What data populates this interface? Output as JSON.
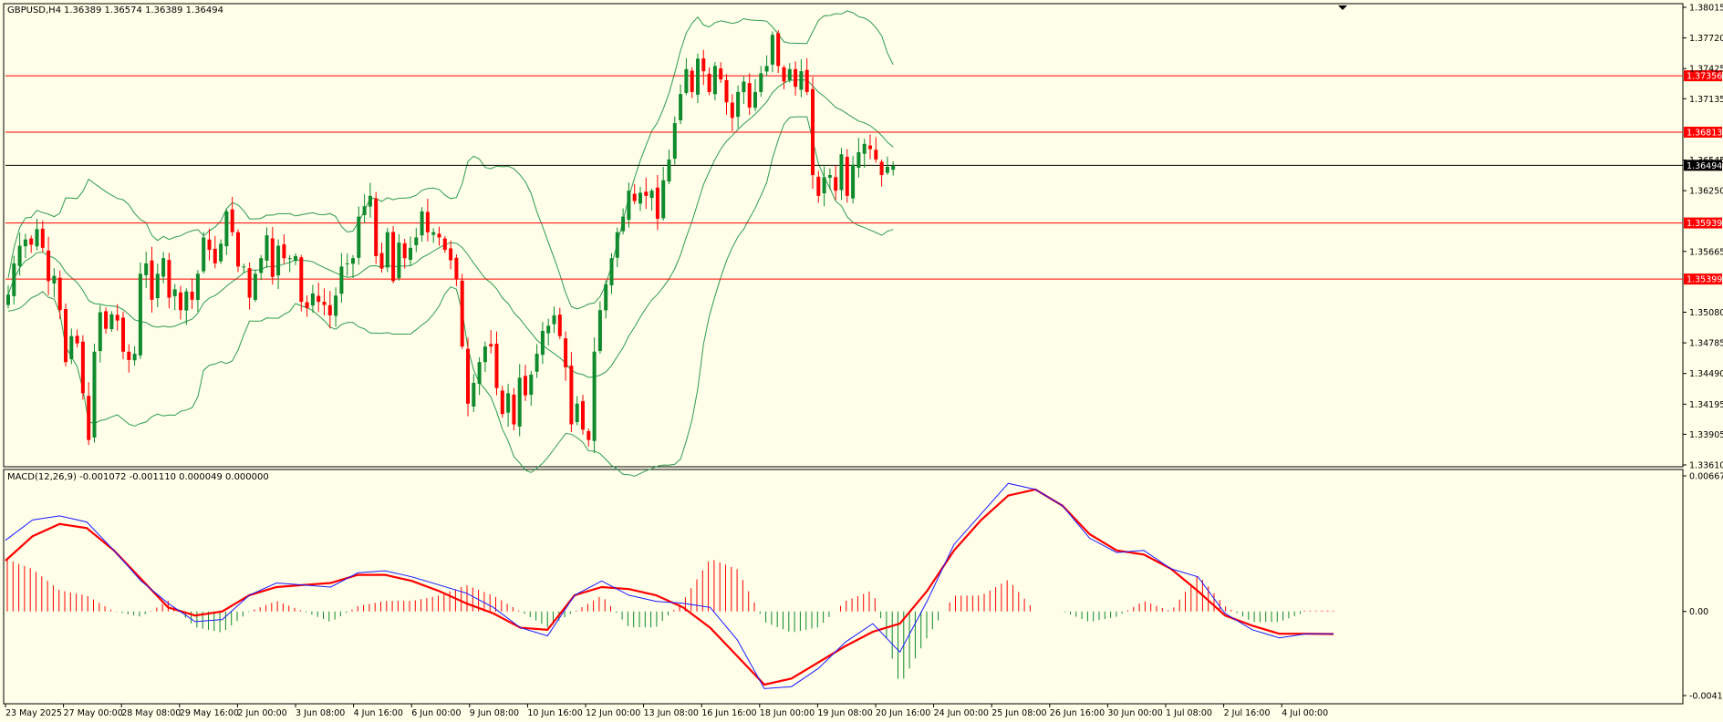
{
  "header": {
    "symbol_label": "GBPUSD,H4",
    "ohlc_label": "1.36389 1.36574 1.36389 1.36494",
    "macd_label": "MACD(12,26,9) -0.001072 -0.001110 0.000049 0.000000"
  },
  "colors": {
    "background": "#fefee9",
    "bull": "#0f8a2c",
    "bear": "#ff0000",
    "band": "#2e9c4f",
    "level_line": "#ff0000",
    "current_price_line": "#000000",
    "macd_main": "#1a1aff",
    "macd_signal": "#ff0000"
  },
  "chart_data": [
    {
      "type": "candlestick",
      "title": "GBPUSD,H4",
      "ylim": [
        1.3361,
        1.38015
      ],
      "y_ticks": [
        "1.38015",
        "1.37720",
        "1.37425",
        "1.37135",
        "1.36545",
        "1.36250",
        "1.35665",
        "1.35080",
        "1.34785",
        "1.34490",
        "1.34195",
        "1.33905",
        "1.33610"
      ],
      "x_ticks": [
        "23 May 2025",
        "27 May 00:00",
        "28 May 08:00",
        "29 May 16:00",
        "2 Jun 00:00",
        "3 Jun 08:00",
        "4 Jun 16:00",
        "6 Jun 00:00",
        "9 Jun 08:00",
        "10 Jun 16:00",
        "12 Jun 00:00",
        "13 Jun 08:00",
        "16 Jun 16:00",
        "18 Jun 00:00",
        "19 Jun 08:00",
        "20 Jun 16:00",
        "24 Jun 00:00",
        "25 Jun 08:00",
        "26 Jun 16:00",
        "30 Jun 00:00",
        "1 Jul 08:00",
        "2 Jul 16:00",
        "4 Jul 00:00"
      ],
      "horizontal_levels": [
        {
          "label": "1.37356",
          "value": 1.37356
        },
        {
          "label": "1.36813",
          "value": 1.36813
        },
        {
          "label": "1.35939",
          "value": 1.35939
        },
        {
          "label": "1.35399",
          "value": 1.35399
        }
      ],
      "current_price": {
        "label": "1.36494",
        "value": 1.36494
      },
      "close": [
        1.3525,
        1.3555,
        1.3572,
        1.3578,
        1.3573,
        1.3588,
        1.357,
        1.3538,
        1.3543,
        1.351,
        1.346,
        1.3485,
        1.3478,
        1.343,
        1.3385,
        1.347,
        1.3508,
        1.3492,
        1.3506,
        1.35,
        1.347,
        1.3462,
        1.3468,
        1.3545,
        1.3555,
        1.352,
        1.3545,
        1.356,
        1.3522,
        1.353,
        1.351,
        1.3528,
        1.352,
        1.3545,
        1.358,
        1.3568,
        1.3555,
        1.3574,
        1.3605,
        1.3585,
        1.3552,
        1.3552,
        1.3522,
        1.3545,
        1.356,
        1.3582,
        1.3542,
        1.3572,
        1.356,
        1.356,
        1.3562,
        1.3518,
        1.3512,
        1.3526,
        1.3518,
        1.3515,
        1.3505,
        1.3524,
        1.3552,
        1.3555,
        1.356,
        1.36,
        1.361,
        1.362,
        1.3562,
        1.355,
        1.3585,
        1.3538,
        1.3575,
        1.356,
        1.357,
        1.358,
        1.3605,
        1.3585,
        1.3585,
        1.358,
        1.3568,
        1.3558,
        1.354,
        1.3475,
        1.342,
        1.344,
        1.346,
        1.3475,
        1.3475,
        1.3435,
        1.341,
        1.343,
        1.34,
        1.3445,
        1.3428,
        1.3448,
        1.3468,
        1.349,
        1.3495,
        1.3505,
        1.3485,
        1.3455,
        1.34,
        1.342,
        1.3395,
        1.3385,
        1.347,
        1.351,
        1.3535,
        1.356,
        1.3585,
        1.36,
        1.3625,
        1.3615,
        1.3623,
        1.362,
        1.3625,
        1.3598,
        1.3635,
        1.3655,
        1.369,
        1.3718,
        1.3742,
        1.372,
        1.3752,
        1.374,
        1.372,
        1.3745,
        1.3732,
        1.371,
        1.3695,
        1.372,
        1.373,
        1.3705,
        1.372,
        1.3738,
        1.3745,
        1.3775,
        1.3745,
        1.373,
        1.3742,
        1.3725,
        1.374,
        1.372,
        1.364,
        1.362,
        1.3638,
        1.364,
        1.3625,
        1.366,
        1.362,
        1.365,
        1.3662,
        1.367,
        1.3665,
        1.3655,
        1.364,
        1.3648,
        1.3649
      ]
    },
    {
      "type": "line",
      "title": "MACD(12,26,9) -0.001072 -0.001110 0.000049 0.000000",
      "ylim": [
        -0.004139,
        0.00667
      ],
      "y_ticks": [
        "0.00667",
        "0.00",
        "-0.004139"
      ],
      "series": [
        {
          "values": [
            0.0035,
            0.0045,
            0.0047,
            0.0044,
            0.003,
            0.0015,
            0.0004,
            -0.0005,
            -0.0004,
            0.0008,
            0.0014,
            0.0013,
            0.0012,
            0.0019,
            0.002,
            0.0017,
            0.0013,
            0.0009,
            0.0002,
            -0.0008,
            -0.0012,
            0.0008,
            0.0015,
            0.0008,
            0.0005,
            0.0004,
            0.0002,
            -0.0014,
            -0.0038,
            -0.0037,
            -0.0028,
            -0.0015,
            -0.0006,
            -0.002,
            0.0005,
            0.0033,
            0.0048,
            0.0063,
            0.006,
            0.0052,
            0.0036,
            0.0029,
            0.003,
            0.0021,
            0.0017,
            -0.0001,
            -0.0009,
            -0.0013,
            -0.0011,
            -0.0011
          ]
        },
        {
          "values": [
            0.0025,
            0.0037,
            0.0043,
            0.0041,
            0.003,
            0.0016,
            0.0002,
            -0.0002,
            0.0,
            0.0008,
            0.0012,
            0.0013,
            0.0014,
            0.0018,
            0.0018,
            0.0015,
            0.001,
            0.0004,
            -0.0001,
            -0.0008,
            -0.0009,
            0.0008,
            0.0012,
            0.0011,
            0.0008,
            0.0002,
            -0.0008,
            -0.0022,
            -0.0036,
            -0.0033,
            -0.0025,
            -0.0017,
            -0.001,
            -0.0006,
            0.001,
            0.003,
            0.0045,
            0.0057,
            0.006,
            0.0052,
            0.0038,
            0.003,
            0.0028,
            0.0021,
            0.001,
            -0.0002,
            -0.0007,
            -0.0011,
            -0.0011,
            -0.00111
          ]
        }
      ]
    }
  ]
}
